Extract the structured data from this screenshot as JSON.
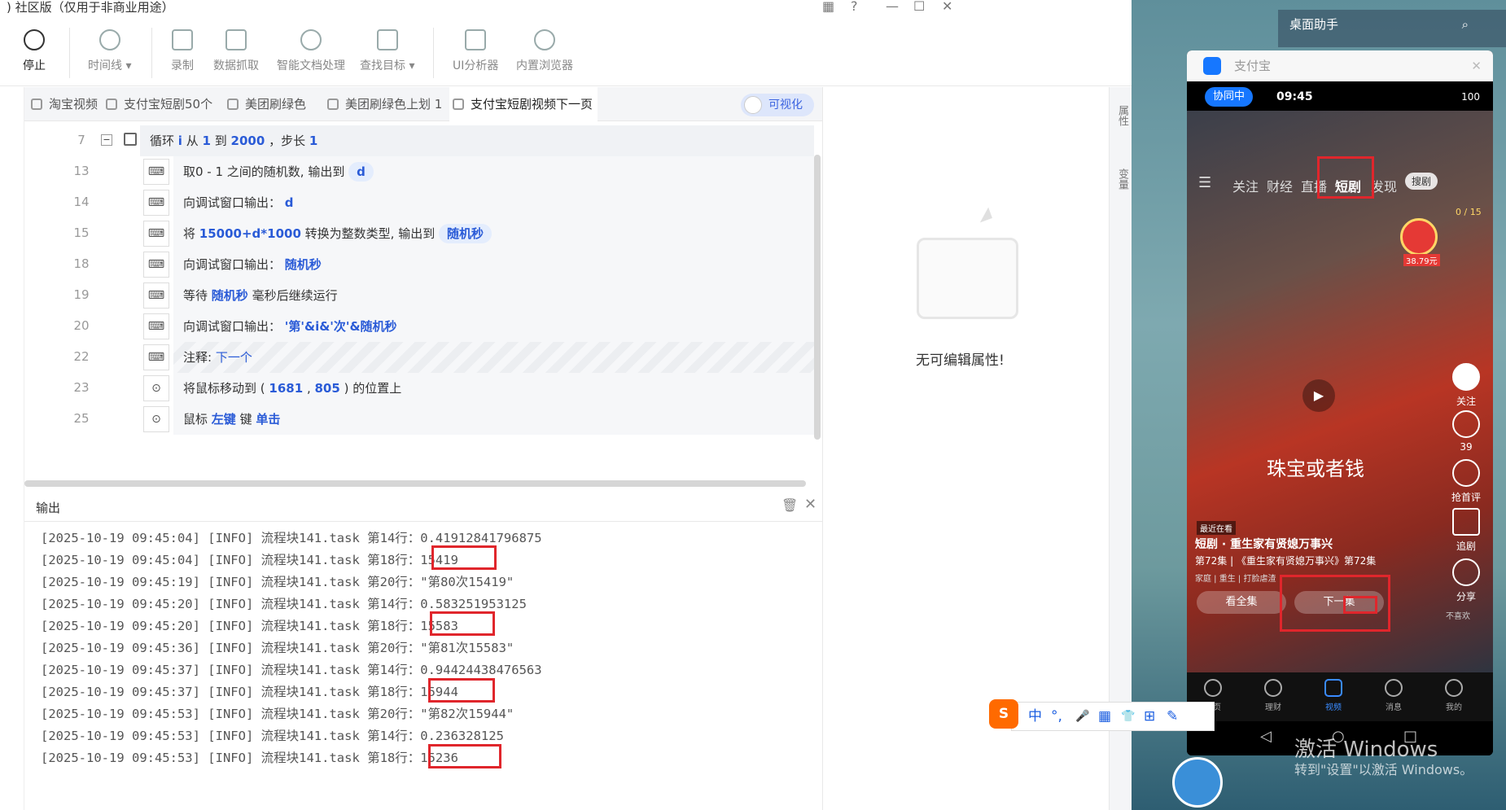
{
  "app": {
    "title": ") 社区版（仅用于非商业用途）",
    "window_controls": [
      "▦",
      "?",
      "—",
      "☐",
      "✕"
    ]
  },
  "toolbar": {
    "stop": "停止",
    "timeline": "时间线 ▾",
    "record": "录制",
    "data_capture": "数据抓取",
    "smart_doc": "智能文档处理",
    "find_target": "查找目标 ▾",
    "ui_analyzer": "UI分析器",
    "browser": "内置浏览器"
  },
  "tabs": [
    {
      "label": "淘宝视频"
    },
    {
      "label": "支付宝短剧50个"
    },
    {
      "label": "美团刷绿色"
    },
    {
      "label": "美团刷绿色上划 1"
    },
    {
      "label": "支付宝短剧视频下一页",
      "close": "✕"
    }
  ],
  "visualize_toggle": "可视化",
  "code": {
    "loop": {
      "num": "7",
      "collapse": "−",
      "t1": "循环",
      "var": "i",
      "t2": "从",
      "from": "1",
      "t3": "到",
      "to": "2000",
      "t4": "，步长",
      "step": "1"
    },
    "rows": [
      {
        "num": "13",
        "text": "取0 - 1 之间的随机数, 输出到",
        "var": "d"
      },
      {
        "num": "14",
        "text": "向调试窗口输出：",
        "kw": "d"
      },
      {
        "num": "15",
        "pre": "将",
        "kw": "15000+d*1000",
        "text": "转换为整数类型, 输出到",
        "var": "随机秒"
      },
      {
        "num": "18",
        "text": "向调试窗口输出：",
        "kw": "随机秒"
      },
      {
        "num": "19",
        "pre": "等待",
        "kw": "随机秒",
        "text": "毫秒后继续运行"
      },
      {
        "num": "20",
        "text": "向调试窗口输出：",
        "kw": "'第'&i&'次'&随机秒"
      },
      {
        "num": "22",
        "text": "注释:",
        "kw": "下一个"
      },
      {
        "num": "23",
        "pre": "将鼠标移动到 (",
        "kw": "1681",
        "sep": ",",
        "kw2": "805",
        "text": ") 的位置上"
      },
      {
        "num": "25",
        "pre": "鼠标",
        "kw": "左键",
        "text": "键",
        "kw2": "单击"
      }
    ]
  },
  "output": {
    "title": "输出",
    "lines": [
      "[2025-10-19 09:45:04] [INFO] 流程块141.task 第14行：0.41912841796875",
      "[2025-10-19 09:45:04] [INFO] 流程块141.task 第18行：15419",
      "[2025-10-19 09:45:19] [INFO] 流程块141.task 第20行：\"第80次15419\"",
      "[2025-10-19 09:45:20] [INFO] 流程块141.task 第14行：0.583251953125",
      "[2025-10-19 09:45:20] [INFO] 流程块141.task 第18行：15583",
      "[2025-10-19 09:45:36] [INFO] 流程块141.task 第20行：\"第81次15583\"",
      "[2025-10-19 09:45:37] [INFO] 流程块141.task 第14行：0.94424438476563",
      "[2025-10-19 09:45:37] [INFO] 流程块141.task 第18行：15944",
      "[2025-10-19 09:45:53] [INFO] 流程块141.task 第20行：\"第82次15944\"",
      "[2025-10-19 09:45:53] [INFO] 流程块141.task 第14行：0.236328125",
      "[2025-10-19 09:45:53] [INFO] 流程块141.task 第18行：15236"
    ]
  },
  "properties": {
    "empty": "无可编辑属性!"
  },
  "sidebar": {
    "props": "属性",
    "vars": "变量"
  },
  "desktop_assistant": {
    "title": "桌面助手"
  },
  "phone": {
    "window_title": "支付宝",
    "status_badge": "协同中",
    "time": "09:45",
    "battery": "100",
    "nav": [
      "关注",
      "财经",
      "直播",
      "短剧",
      "发现"
    ],
    "search": "搜剧",
    "progress": "0 / 15",
    "coin": "38.79元",
    "follow": "关注",
    "likes": "39",
    "comment": "抢首评",
    "chase": "追剧",
    "share": "分享",
    "dislike": "不喜欢",
    "caption": "珠宝或者钱",
    "recent_tag": "最近在看",
    "show_title": "短剧 · 重生家有贤媳万事兴",
    "episode": "第72集 | 《重生家有贤媳万事兴》第72集",
    "tags": "家庭 | 重生 | 打脸虐渣",
    "watch_all": "看全集",
    "next_ep": "下一集",
    "bottom_nav": [
      "首页",
      "理财",
      "视频",
      "消息",
      "我的"
    ]
  },
  "ime": {
    "items": [
      "中",
      "°,",
      "🎤",
      "▦",
      "👕",
      "⊞",
      "✎"
    ]
  },
  "watermark": {
    "line1": "激活 Windows",
    "line2": "转到\"设置\"以激活 Windows。"
  }
}
